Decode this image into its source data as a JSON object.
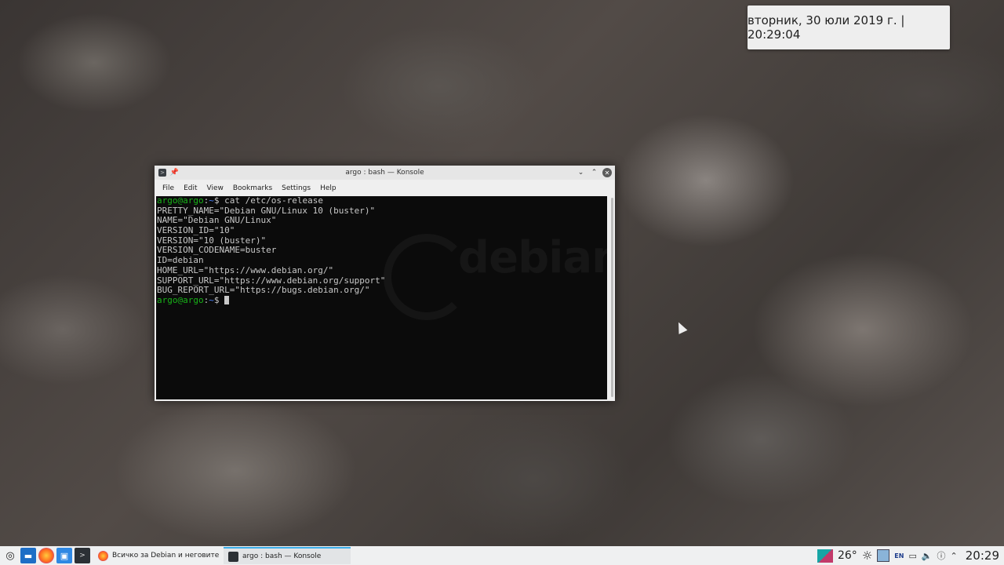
{
  "clock": {
    "text": "вторник, 30 юли 2019 г. | 20:29:04"
  },
  "window": {
    "title": "argo : bash — Konsole",
    "menu": [
      "File",
      "Edit",
      "View",
      "Bookmarks",
      "Settings",
      "Help"
    ]
  },
  "terminal": {
    "prompt_user": "argo@argo",
    "prompt_sep": ":",
    "prompt_path": "~",
    "prompt_sign": "$",
    "command": " cat /etc/os-release",
    "output": [
      "PRETTY_NAME=\"Debian GNU/Linux 10 (buster)\"",
      "NAME=\"Debian GNU/Linux\"",
      "VERSION_ID=\"10\"",
      "VERSION=\"10 (buster)\"",
      "VERSION_CODENAME=buster",
      "ID=debian",
      "HOME_URL=\"https://www.debian.org/\"",
      "SUPPORT_URL=\"https://www.debian.org/support\"",
      "BUG_REPORT_URL=\"https://bugs.debian.org/\""
    ],
    "watermark": "debian"
  },
  "taskbar": {
    "tasks": [
      {
        "label": "Всичко за Debian и неговите вну...",
        "icon": "firefox-icon"
      },
      {
        "label": "argo : bash — Konsole",
        "icon": "konsole-icon"
      }
    ],
    "temperature": "26°",
    "language": "EN",
    "time": "20:29"
  },
  "colors": {
    "prompt": "#18b218",
    "path": "#4a84ff",
    "terminal_bg": "#0b0b0b",
    "taskbar_bg": "#eff0f1",
    "active_accent": "#3daee9"
  }
}
